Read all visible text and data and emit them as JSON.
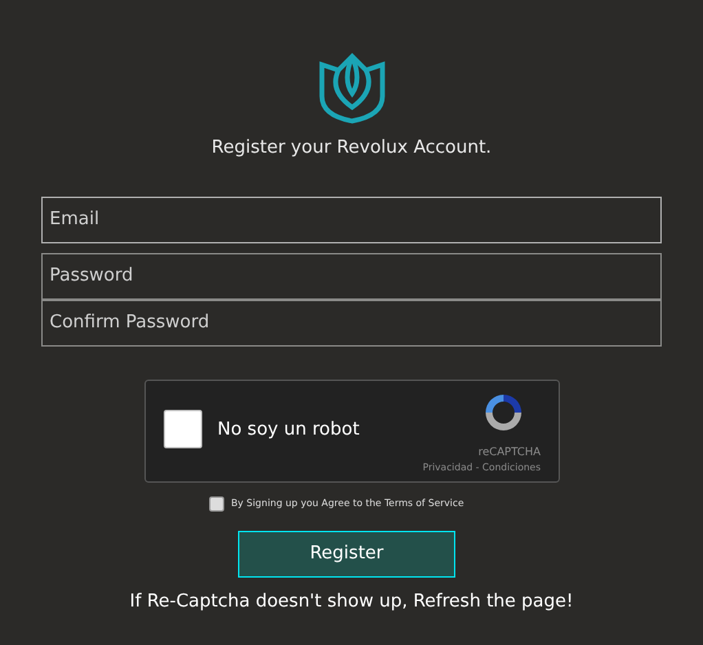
{
  "heading": "Register your Revolux Account.",
  "fields": [
    {
      "placeholder": "Email",
      "focused": true
    },
    {
      "placeholder": "Password",
      "focused": false
    },
    {
      "placeholder": "Confirm Password",
      "focused": false
    }
  ],
  "captcha": {
    "label": "No soy un robot",
    "checked": false,
    "brand": "reCAPTCHA",
    "links": "Privacidad - Condiciones"
  },
  "terms": {
    "label": "By Signing up you Agree to the Terms of Service",
    "checked": false
  },
  "submit": "Register",
  "note": "If Re-Captcha doesn't show up, Refresh the page!"
}
